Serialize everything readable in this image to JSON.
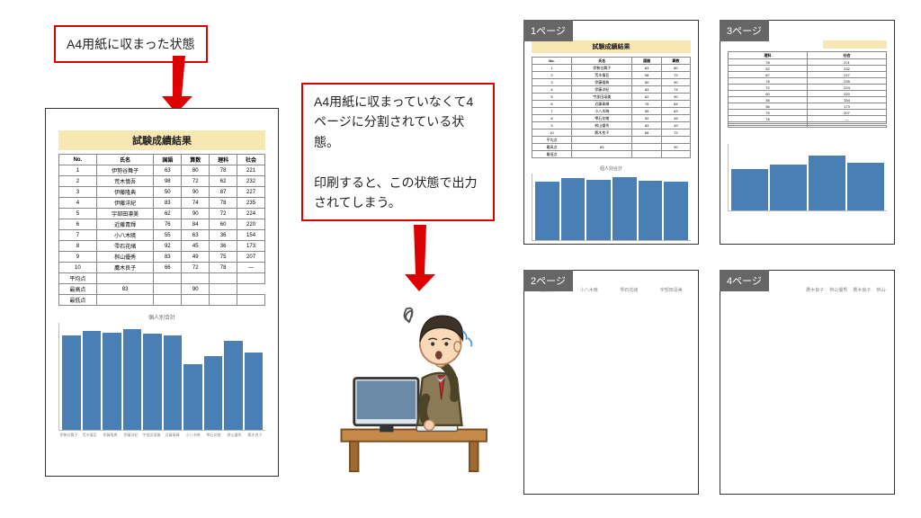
{
  "callouts": {
    "left": "A4用紙に収まった状態",
    "right": "A4用紙に収まっていなくて4ページに分割されている状態。\n\n印刷すると、この状態で出力されてしまう。"
  },
  "page_tags": {
    "p1": "1ページ",
    "p2": "2ページ",
    "p3": "3ページ",
    "p4": "4ページ"
  },
  "report": {
    "title": "試験成績結果",
    "headers": [
      "No.",
      "氏名",
      "国語",
      "算数",
      "理科",
      "社会"
    ],
    "rows": [
      [
        "1",
        "伊勢谷舞子",
        "63",
        "80",
        "78",
        "221"
      ],
      [
        "2",
        "荒木慎吾",
        "98",
        "72",
        "62",
        "232"
      ],
      [
        "3",
        "伊藤隆典",
        "50",
        "90",
        "87",
        "227"
      ],
      [
        "4",
        "伊藤洋紀",
        "83",
        "74",
        "78",
        "235"
      ],
      [
        "5",
        "宇部田凛美",
        "62",
        "90",
        "72",
        "224"
      ],
      [
        "6",
        "近藤青輝",
        "76",
        "84",
        "60",
        "220"
      ],
      [
        "7",
        "小八木暁",
        "55",
        "63",
        "36",
        "154"
      ],
      [
        "8",
        "雫石花緒",
        "92",
        "45",
        "36",
        "173"
      ],
      [
        "9",
        "桝山優秀",
        "83",
        "49",
        "75",
        "207"
      ],
      [
        "10",
        "鷹木良子",
        "66",
        "72",
        "78",
        "—"
      ]
    ],
    "summary": [
      [
        "平均点",
        "",
        "",
        "",
        "",
        ""
      ],
      [
        "最高点",
        "83",
        "",
        "90",
        ""
      ],
      [
        "最低点",
        "",
        "",
        "",
        "",
        ""
      ]
    ]
  },
  "chart_data": {
    "type": "bar",
    "title": "個人別合計",
    "categories": [
      "伊勢谷舞子",
      "荒木慎吾",
      "伊藤隆典",
      "伊藤洋紀",
      "宇部田凛美",
      "近藤青輝",
      "小八木暁",
      "雫石花緒",
      "桝山優秀",
      "鷹木良子"
    ],
    "values": [
      221,
      232,
      227,
      235,
      224,
      220,
      154,
      173,
      207,
      180
    ],
    "ylim": [
      0,
      250
    ],
    "xlabel": "",
    "ylabel": ""
  },
  "split": {
    "p1": {
      "cols": 4,
      "bars": 6
    },
    "p3": {
      "cols": 2,
      "bars": 4
    },
    "p2_labels": [
      "近藤青輝",
      "小八木暁",
      "雫石花緒",
      "宇部田凛美"
    ],
    "p4_labels": [
      "鷹木良子",
      "桝山優秀",
      "鷹木良子",
      "桝山-"
    ]
  }
}
